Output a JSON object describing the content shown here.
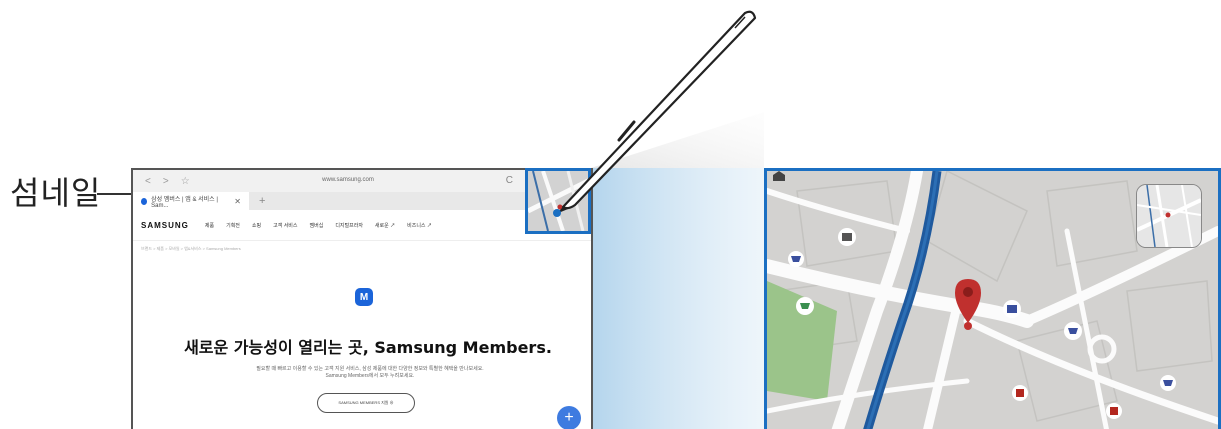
{
  "callout": {
    "label": "섬네일"
  },
  "browser": {
    "url": "www.samsung.com",
    "tab_title": "삼성 멤버스 | 앱 & 서비스 | Sam...",
    "tab_close": "✕",
    "tab_add": "+",
    "back": "<",
    "forward": ">",
    "bookmark": "☆",
    "reload": "C"
  },
  "site": {
    "logo": "SAMSUNG",
    "nav": [
      "제품",
      "기획전",
      "쇼핑",
      "고객 서비스",
      "멤버십",
      "디지털프라자",
      "새로운 ↗",
      "비즈니스 ↗"
    ],
    "breadcrumb": "브랜드 > 제품 > 모바일 > 앱&서비스 > Samsung Members",
    "members_glyph": "M",
    "headline": "새로운 가능성이 열리는 곳, Samsung Members.",
    "subtext_line1": "필요할 때 빠르고 이용할 수 있는 고객 지원 서비스, 삼성 제품에 대한 다양한 정보와 특별한 혜택을 만나보세요.",
    "subtext_line2": "Samsung Members에서 모두 누려보세요.",
    "cta": "SAMSUNG MEMBERS 지원 ⊕",
    "fab": "+"
  },
  "colors": {
    "accent": "#1b6fc2",
    "map_bg": "#d3d2d0",
    "water": "#1f5a9e",
    "park": "#8fbf7a",
    "pin": "#c0302e"
  }
}
